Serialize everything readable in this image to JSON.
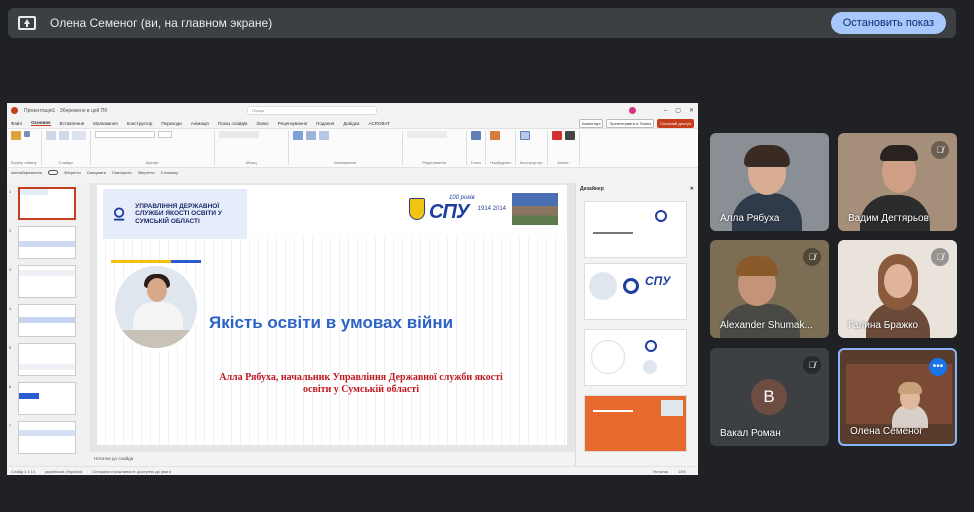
{
  "presenting": {
    "title": "Олена Семеног (ви, на главном экране)",
    "stop_label": "Остановить показ"
  },
  "ppt": {
    "window_title": "Презентація1 · Збережено в цей ПК",
    "search_placeholder": "Пошук",
    "tabs": [
      "Файл",
      "Основне",
      "Вставлення",
      "Малювання",
      "Конструктор",
      "Переходи",
      "Анімація",
      "Показ слайдів",
      "Запис",
      "Рецензування",
      "Подання",
      "Довідка",
      "ACROBAT"
    ],
    "active_tab": "Основне",
    "tab_buttons": [
      "Коментарі",
      "Презентувати в Teams",
      "Спільний доступ"
    ],
    "ribbon_groups": [
      "Буфер обміну",
      "Слайди",
      "Шрифт",
      "Абзац",
      "Малювання",
      "Редагування",
      "Голос",
      "Надбудови",
      "Конструктор",
      "Adobe"
    ],
    "qat": [
      "Автозбереження",
      "Зберегти",
      "Скасувати",
      "Повторити",
      "Зберегти",
      "З початку"
    ],
    "notes_label": "Нотатки до слайда",
    "status_left": "Слайд 1 з 14",
    "status_lang": "українська (Україна)",
    "status_access": "Спеціальні можливості: доступно до уваги",
    "status_right": "Нотатки",
    "zoom": "14%",
    "designer_title": "Дизайнер",
    "slide": {
      "org_text": "УПРАВЛІННЯ ДЕРЖАВНОЇ СЛУЖБИ ЯКОСТІ ОСВІТИ У СУМСЬКІЙ ОБЛАСТІ",
      "spu_text": "СПУ",
      "spu_anniversary": "100 років",
      "spu_years": "1914 2014",
      "title": "Якість освіти в умовах війни",
      "subtitle": "Алла Рябуха, начальник Управління Державної служби якості освіти у Сумській області"
    },
    "thumb_numbers": [
      "1",
      "2",
      "3",
      "4",
      "5",
      "6",
      "7"
    ]
  },
  "participants": [
    {
      "name": "Алла Рябуха",
      "muted": false
    },
    {
      "name": "Вадим Дегтярьов",
      "muted": true
    },
    {
      "name": "Alexander Shumak...",
      "muted": true
    },
    {
      "name": "Галина Бражко",
      "muted": true
    },
    {
      "name": "Вакал Роман",
      "muted": true,
      "initial": "В"
    },
    {
      "name": "Олена Семеног",
      "muted": false,
      "self": true
    }
  ]
}
